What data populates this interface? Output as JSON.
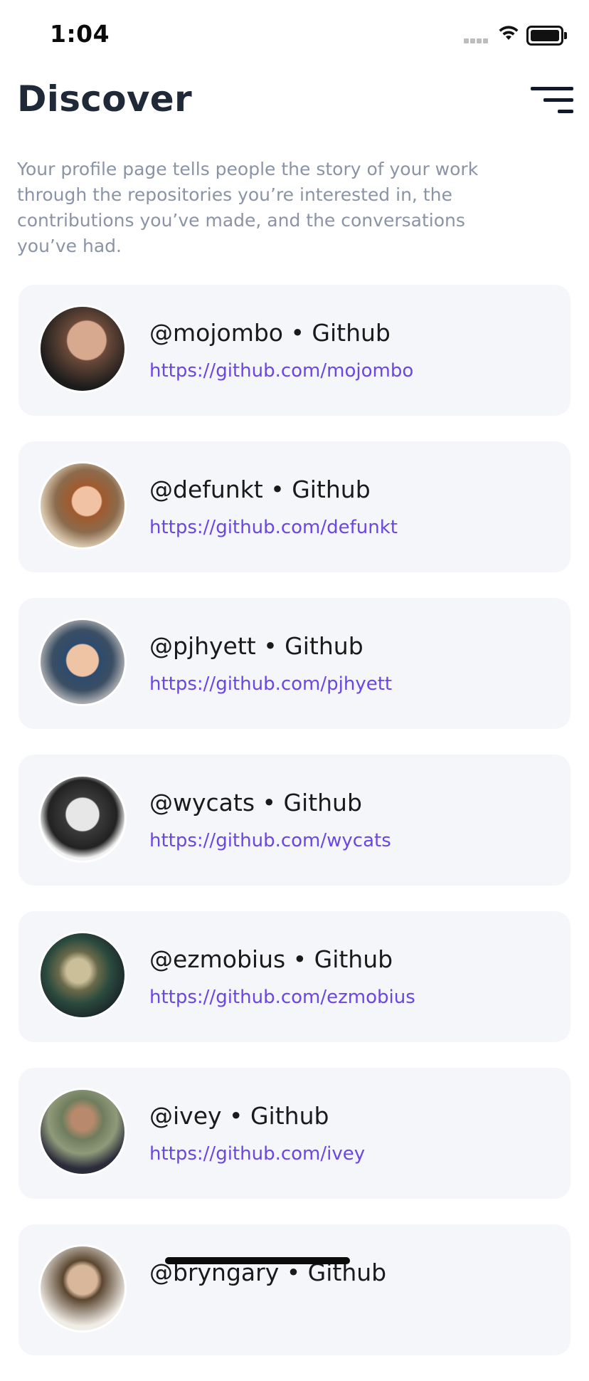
{
  "status_bar": {
    "time": "1:04"
  },
  "header": {
    "title": "Discover",
    "description": "Your profile page tells people the story of your work through the repositories you’re interested in, the contributions you’ve made, and the conversations you’ve had."
  },
  "icons": {
    "filter": "filter-icon"
  },
  "profiles": [
    {
      "handle": "@mojombo • Github",
      "url": "https://github.com/mojombo"
    },
    {
      "handle": "@defunkt • Github",
      "url": "https://github.com/defunkt"
    },
    {
      "handle": "@pjhyett • Github",
      "url": "https://github.com/pjhyett"
    },
    {
      "handle": "@wycats • Github",
      "url": "https://github.com/wycats"
    },
    {
      "handle": "@ezmobius • Github",
      "url": "https://github.com/ezmobius"
    },
    {
      "handle": "@ivey • Github",
      "url": "https://github.com/ivey"
    },
    {
      "handle": "@bryngary • Github",
      "url": ""
    }
  ],
  "colors": {
    "accent": "#6b46e6",
    "card_background": "#f4f6f9",
    "description_text": "#8a94a6",
    "title_text": "#1f2937"
  }
}
